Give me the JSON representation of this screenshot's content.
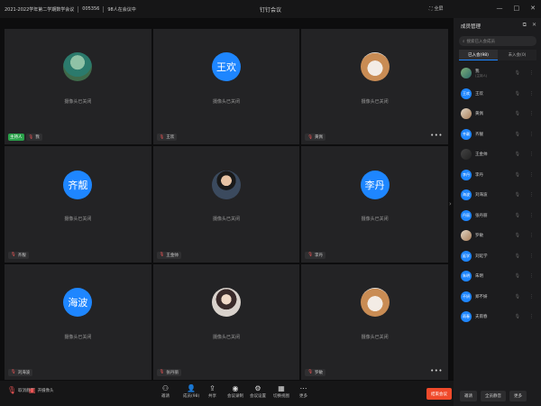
{
  "window": {
    "app_title": "钉钉会议",
    "meeting_topic": "2021-2022学年第二学期数学会议",
    "meeting_id": "005356",
    "online_count": "98人在会议中",
    "fullscreen_label": "全屏"
  },
  "tiles": [
    {
      "name": "我",
      "status": "摄像头已关闭",
      "host": true,
      "host_label": "主持人",
      "avatar_text": "",
      "art": "leaf",
      "more": false
    },
    {
      "name": "王欢",
      "status": "摄像头已关闭",
      "host": false,
      "avatar_text": "王欢",
      "art": "",
      "more": false
    },
    {
      "name": "黄佩",
      "status": "摄像头已关闭",
      "host": false,
      "avatar_text": "",
      "art": "dog",
      "more": true
    },
    {
      "name": "齐靓",
      "status": "摄像头已关闭",
      "host": false,
      "avatar_text": "齐靓",
      "art": "",
      "more": false
    },
    {
      "name": "王金帅",
      "status": "摄像头已关闭",
      "host": false,
      "avatar_text": "",
      "art": "man",
      "more": false
    },
    {
      "name": "李丹",
      "status": "摄像头已关闭",
      "host": false,
      "avatar_text": "李丹",
      "art": "",
      "more": false
    },
    {
      "name": "刘海波",
      "status": "摄像头已关闭",
      "host": false,
      "avatar_text": "海波",
      "art": "",
      "more": false
    },
    {
      "name": "张丹丽",
      "status": "摄像头已关闭",
      "host": false,
      "avatar_text": "",
      "art": "girl",
      "more": false
    },
    {
      "name": "罗敏",
      "status": "摄像头已关闭",
      "host": false,
      "avatar_text": "",
      "art": "dog",
      "more": true
    }
  ],
  "panel": {
    "title": "成员管理",
    "search_placeholder": "搜索已入会成员",
    "tab_joined": "已入会(98)",
    "tab_not_joined": "未入会(0)",
    "members": [
      {
        "name": "我",
        "sub": "(主持人)",
        "avatar": "",
        "style": "photo"
      },
      {
        "name": "王欢",
        "sub": "",
        "avatar": "王欢",
        "style": ""
      },
      {
        "name": "黄佩",
        "sub": "",
        "avatar": "",
        "style": "photo2"
      },
      {
        "name": "齐靓",
        "sub": "",
        "avatar": "齐靓",
        "style": ""
      },
      {
        "name": "王金帅",
        "sub": "",
        "avatar": "",
        "style": "photo3"
      },
      {
        "name": "李丹",
        "sub": "",
        "avatar": "李丹",
        "style": ""
      },
      {
        "name": "刘海波",
        "sub": "",
        "avatar": "海波",
        "style": ""
      },
      {
        "name": "张丹丽",
        "sub": "",
        "avatar": "丹丽",
        "style": ""
      },
      {
        "name": "罗敏",
        "sub": "",
        "avatar": "",
        "style": "photo2"
      },
      {
        "name": "刘延学",
        "sub": "",
        "avatar": "延学",
        "style": ""
      },
      {
        "name": "朱明",
        "sub": "",
        "avatar": "朱明",
        "style": ""
      },
      {
        "name": "郑不妍",
        "sub": "",
        "avatar": "不妍",
        "style": ""
      },
      {
        "name": "夫雨春",
        "sub": "",
        "avatar": "雨春",
        "style": ""
      }
    ],
    "btn_invite": "邀请",
    "btn_mute_all": "全员静音",
    "btn_more": "更多"
  },
  "toolbar": {
    "mute_label": "取消静音",
    "camera_label": "开摄像头",
    "invite_label": "邀请",
    "members_label": "成员(98)",
    "share_label": "共享",
    "record_label": "会议录制",
    "settings_label": "会议设置",
    "layout_label": "切换视图",
    "more_label": "更多",
    "end_label": "结束会议"
  },
  "colors": {
    "accent": "#1e86ff",
    "end": "#f04a2b",
    "host": "#2aa14a"
  }
}
